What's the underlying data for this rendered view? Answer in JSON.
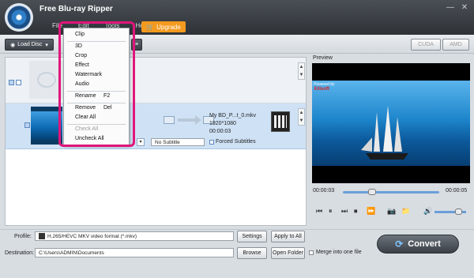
{
  "app": {
    "title": "Free Blu-ray Ripper"
  },
  "window": {
    "min": "—",
    "close": "✕"
  },
  "menu": {
    "file": "File",
    "edit": "Edit",
    "tools": "Tools",
    "help": "Help"
  },
  "upgrade": {
    "label": "Upgrade"
  },
  "toolbar": {
    "load_disc": "Load Disc",
    "cuda": "CUDA",
    "amd": "AMD"
  },
  "file_row": {
    "output_name": "My BD_P...t_0.mkv",
    "resolution": "1920*1080",
    "duration": "00:00:03",
    "subtitle": "No Subtitle",
    "forced_subtitles": "Forced Subtitles"
  },
  "edit_menu": {
    "items": [
      "Clip",
      "3D",
      "Crop",
      "Effect",
      "Watermark",
      "Audio",
      "Rename",
      "Remove",
      "Clear All",
      "Check All",
      "Uncheck All"
    ],
    "shortcuts": {
      "rename": "F2",
      "remove": "Del"
    }
  },
  "preview": {
    "label": "Preview",
    "powered_by": "Powered by",
    "brand": "Xilisoft",
    "time_current": "00:00:03",
    "time_total": "00:00:05",
    "seek_progress": 0.3
  },
  "bottom": {
    "profile_label": "Profile:",
    "profile_value": "H.265/HEVC MKV video format (*.mkv)",
    "settings": "Settings",
    "apply_all": "Apply to All",
    "destination_label": "Destination:",
    "destination_value": "C:\\Users\\ADMIN\\Documents",
    "browse": "Browse",
    "open_folder": "Open Folder",
    "merge": "Merge into one file",
    "convert": "Convert"
  },
  "colors": {
    "accent": "#e0157a",
    "upgrade": "#f39a1f"
  }
}
